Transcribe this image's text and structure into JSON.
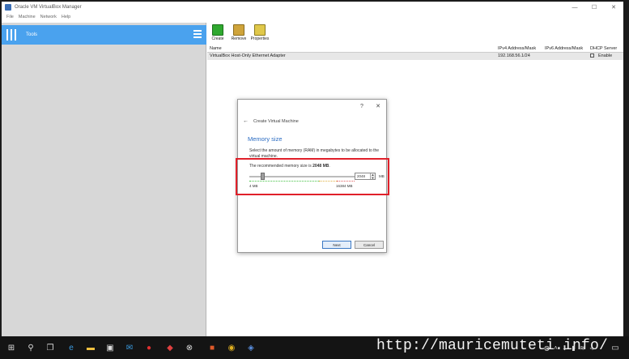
{
  "window": {
    "title": "Oracle VM VirtualBox Manager",
    "controls": [
      "—",
      "☐",
      "✕"
    ]
  },
  "menu": [
    "File",
    "Machine",
    "Network",
    "Help"
  ],
  "left_pane": {
    "tools_label": "Tools"
  },
  "toolbar": {
    "create_label": "Create",
    "remove_label": "Remove",
    "properties_label": "Properties"
  },
  "table": {
    "headers": [
      "Name",
      "IPv4 Address/Mask",
      "IPv6 Address/Mask",
      "DHCP Server"
    ],
    "rows": [
      {
        "name": "VirtualBox Host-Only Ethernet Adapter",
        "ipv4": "192.168.56.1/24",
        "ipv6": "",
        "dhcp": "Enable"
      }
    ]
  },
  "dialog": {
    "help_glyph": "?",
    "close_glyph": "✕",
    "back_glyph": "←",
    "title": "Create Virtual Machine",
    "section": "Memory size",
    "description": "Select the amount of memory (RAM) in megabytes to be allocated to the virtual machine.",
    "recommended_prefix": "The recommended memory size is ",
    "recommended_value": "2048 MB",
    "recommended_suffix": ".",
    "memory_value": "2048",
    "memory_fraction": 0.124,
    "unit": "MB",
    "min_label": "4 MB",
    "max_label": "16384 MB",
    "next_label": "Next",
    "cancel_label": "Cancel"
  },
  "taskbar": {
    "url": "http://mauricemuteti.info/"
  },
  "colors": {
    "tools_bg": "#4aa2ee",
    "section_title": "#2a6bc2",
    "highlight": "#e0202a"
  }
}
